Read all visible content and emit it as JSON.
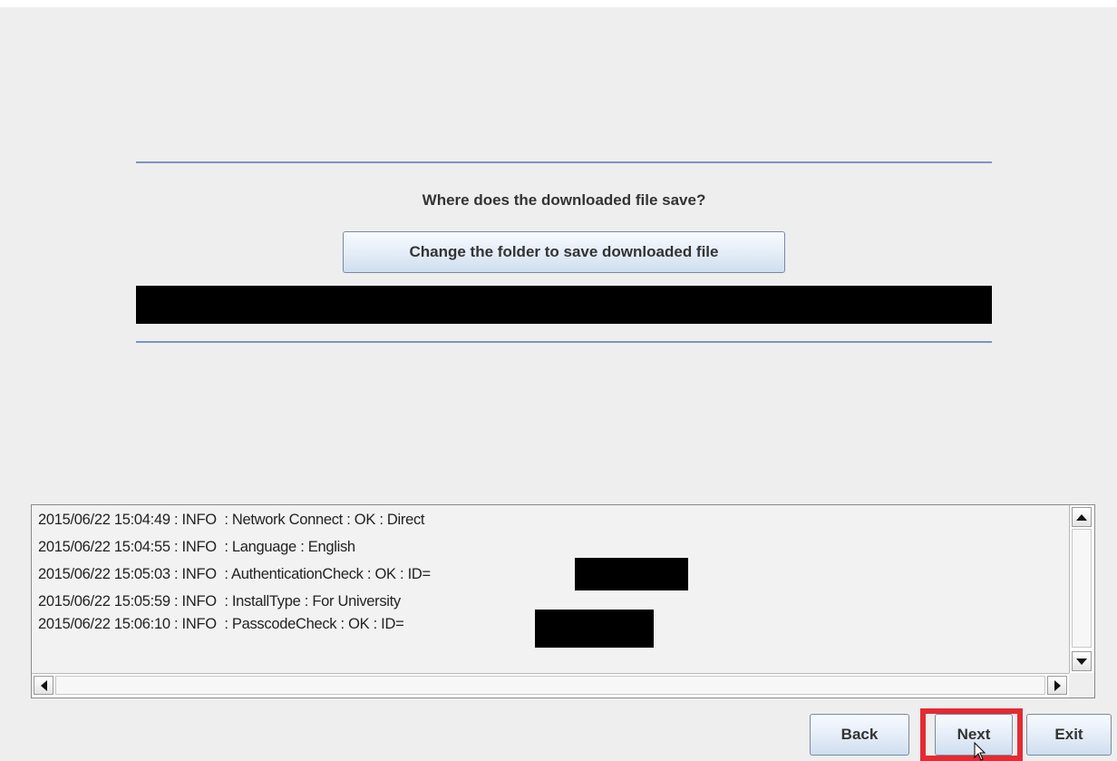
{
  "dialog": {
    "question": "Where does the downloaded file save?",
    "change_folder_label": "Change the folder to save downloaded file"
  },
  "log": {
    "lines": [
      "2015/06/22 15:04:49 : INFO  : Network Connect : OK : Direct",
      "2015/06/22 15:04:55 : INFO  : Language : English",
      "2015/06/22 15:05:03 : INFO  : AuthenticationCheck : OK : ID=",
      "2015/06/22 15:05:59 : INFO  : InstallType : For University",
      "2015/06/22 15:06:10 : INFO  : PasscodeCheck : OK : ID="
    ]
  },
  "footer": {
    "back_label": "Back",
    "next_label": "Next",
    "exit_label": "Exit"
  },
  "icons": {
    "scroll_up": "arrow-up-icon",
    "scroll_down": "arrow-down-icon",
    "scroll_left": "arrow-left-icon",
    "scroll_right": "arrow-right-icon",
    "cursor": "mouse-pointer-icon"
  },
  "colors": {
    "background": "#eeeeee",
    "rule": "#7a95c7",
    "highlight": "#e52a32",
    "redaction": "#000000"
  }
}
